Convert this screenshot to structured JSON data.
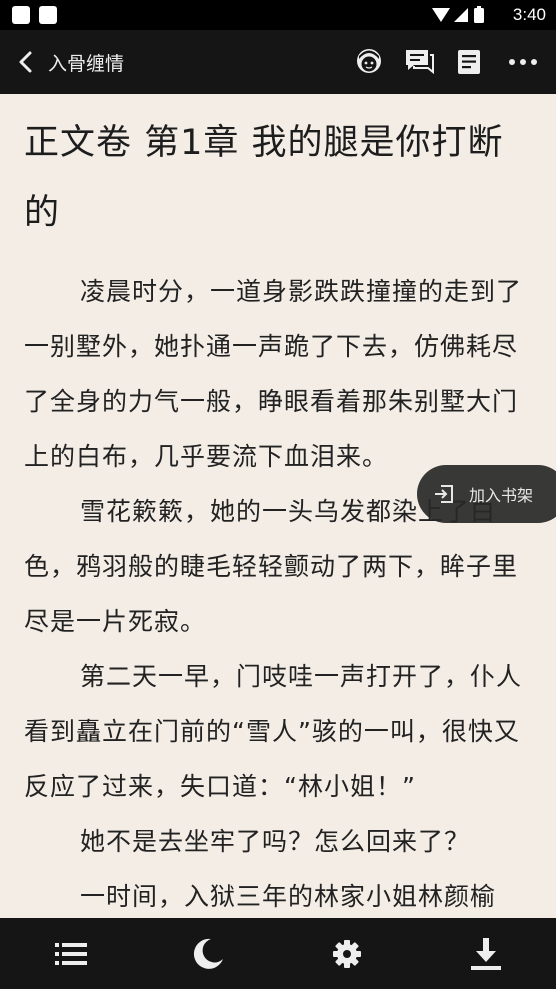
{
  "status_bar": {
    "time": "3:40"
  },
  "app_bar": {
    "book_title": "入骨缠情"
  },
  "content": {
    "chapter_title": "正文卷 第1章 我的腿是你打断的",
    "paragraphs": [
      "凌晨时分，一道身影跌跌撞撞的走到了一别墅外，她扑通一声跪了下去，仿佛耗尽了全身的力气一般，睁眼看着那朱别墅大门上的白布，几乎要流下血泪来。",
      "雪花簌簌，她的一头乌发都染上了白色，鸦羽般的睫毛轻轻颤动了两下，眸子里尽是一片死寂。",
      "第二天一早，门吱哇一声打开了，仆人看到矗立在门前的“雪人”骇的一叫，很快又反应了过来，失口道：“林小姐！”",
      "她不是去坐牢了吗？怎么回来了？",
      "一时间，入狱三年的林家小姐林颜榆"
    ]
  },
  "floating": {
    "add_to_shelf_label": "加入书架"
  },
  "colors": {
    "background": "#f3ede6",
    "bars": "#151515",
    "text": "#222222"
  }
}
